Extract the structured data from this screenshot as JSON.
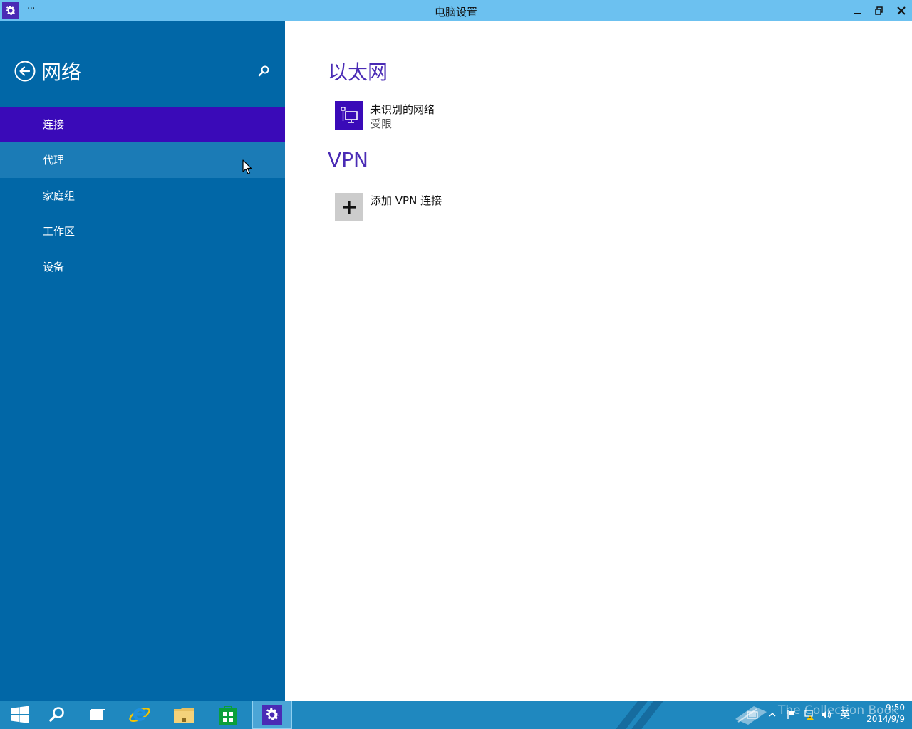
{
  "window": {
    "title": "电脑设置",
    "menu_label": "···"
  },
  "sidebar": {
    "section_title": "网络",
    "items": [
      {
        "label": "连接",
        "state": "selected"
      },
      {
        "label": "代理",
        "state": "hover"
      },
      {
        "label": "家庭组",
        "state": "normal"
      },
      {
        "label": "工作区",
        "state": "normal"
      },
      {
        "label": "设备",
        "state": "normal"
      }
    ]
  },
  "content": {
    "ethernet": {
      "heading": "以太网",
      "connection_name": "未识别的网络",
      "connection_status": "受限"
    },
    "vpn": {
      "heading": "VPN",
      "add_label": "添加 VPN 连接"
    }
  },
  "taskbar": {
    "watermark": "The Collection Book",
    "ime_label": "英",
    "time": "9:50",
    "date": "2014/9/9"
  },
  "colors": {
    "accent": "#3a0ab8",
    "sidebar_bg": "#0167a7",
    "titlebar_bg": "#6cc1f0",
    "taskbar_bg": "#1f88bf"
  }
}
